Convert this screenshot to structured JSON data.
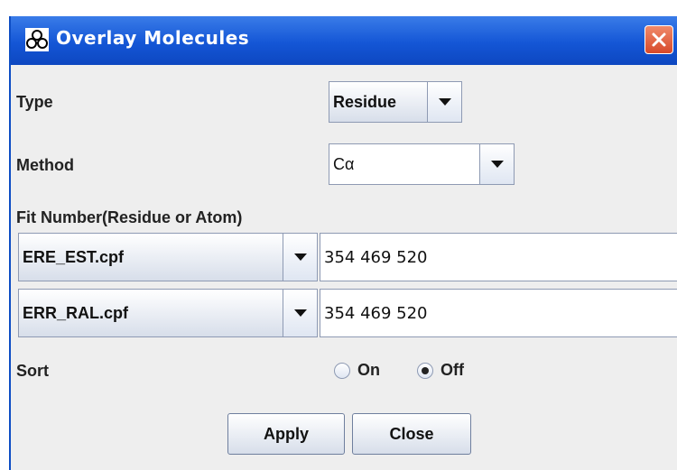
{
  "dialog": {
    "title": "Overlay Molecules"
  },
  "type": {
    "label": "Type",
    "selected": "Residue"
  },
  "method": {
    "label": "Method",
    "selected": "Cα"
  },
  "fit": {
    "label": "Fit Number(Residue or Atom)",
    "rows": [
      {
        "file": "ERE_EST.cpf",
        "numbers": "354 469 520"
      },
      {
        "file": "ERR_RAL.cpf",
        "numbers": "354 469 520"
      }
    ]
  },
  "sort": {
    "label": "Sort",
    "on_label": "On",
    "off_label": "Off",
    "selected": "Off"
  },
  "buttons": {
    "apply": "Apply",
    "close": "Close"
  },
  "icons": {
    "app": "molecule-icon",
    "close": "close-icon",
    "dropdown": "chevron-down-icon"
  },
  "colors": {
    "titlebar": "#1456d6",
    "close_button": "#d7492a"
  }
}
